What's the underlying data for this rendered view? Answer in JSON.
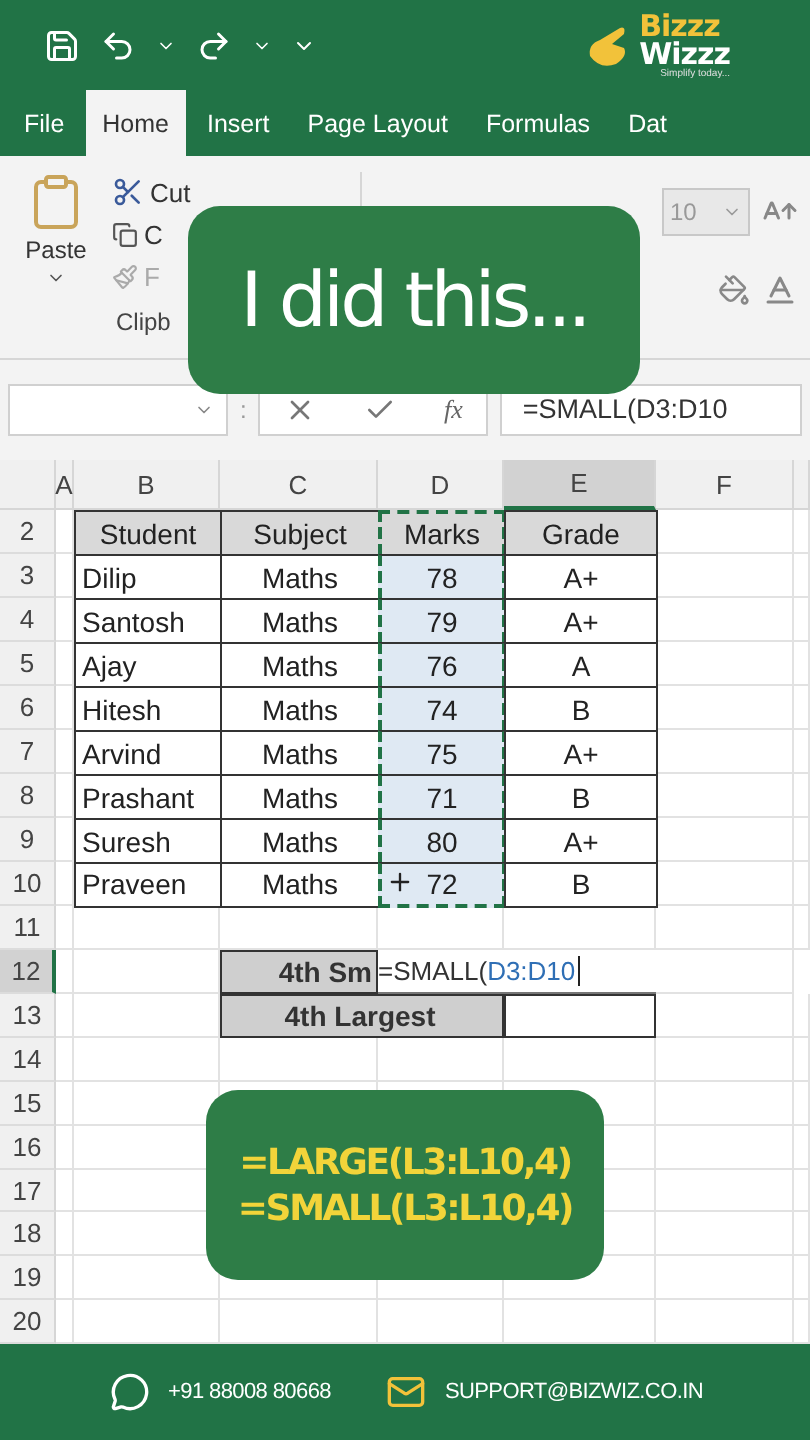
{
  "logo": {
    "line_1": "Bizzz",
    "line_2": "Wizzz",
    "tagline": "Simplify today..."
  },
  "tabs": [
    {
      "label": "File",
      "selected": false
    },
    {
      "label": "Home",
      "selected": true
    },
    {
      "label": "Insert",
      "selected": false
    },
    {
      "label": "Page Layout",
      "selected": false
    },
    {
      "label": "Formulas",
      "selected": false
    },
    {
      "label": "Dat",
      "selected": false
    }
  ],
  "ribbon": {
    "paste": "Paste",
    "cut": "Cut",
    "copy": "C",
    "format_painter": "F",
    "group_label": "Clipb",
    "font_size": "10"
  },
  "caption_top": "I did this...",
  "formula_bar": {
    "separator": ":",
    "function_label": "fx",
    "formula": "=SMALL(D3:D10"
  },
  "column_letters": [
    {
      "label": "A",
      "selected": false
    },
    {
      "label": "B",
      "selected": false
    },
    {
      "label": "C",
      "selected": false
    },
    {
      "label": "D",
      "selected": false
    },
    {
      "label": "E",
      "selected": true
    },
    {
      "label": "F",
      "selected": false
    }
  ],
  "row_numbers": [
    {
      "label": "2",
      "selected": false
    },
    {
      "label": "3",
      "selected": false
    },
    {
      "label": "4",
      "selected": false
    },
    {
      "label": "5",
      "selected": false
    },
    {
      "label": "6",
      "selected": false
    },
    {
      "label": "7",
      "selected": false
    },
    {
      "label": "8",
      "selected": false
    },
    {
      "label": "9",
      "selected": false
    },
    {
      "label": "10",
      "selected": false
    },
    {
      "label": "11",
      "selected": false
    },
    {
      "label": "12",
      "selected": true
    },
    {
      "label": "13",
      "selected": false
    },
    {
      "label": "14",
      "selected": false
    },
    {
      "label": "15",
      "selected": false
    },
    {
      "label": "16",
      "selected": false
    },
    {
      "label": "17",
      "selected": false
    },
    {
      "label": "18",
      "selected": false
    },
    {
      "label": "19",
      "selected": false
    },
    {
      "label": "20",
      "selected": false
    }
  ],
  "table": {
    "columns": [
      {
        "label": "Student",
        "selected": false
      },
      {
        "label": "Subject",
        "selected": false
      },
      {
        "label": "Marks",
        "selected": true
      },
      {
        "label": "Grade",
        "selected": false
      }
    ],
    "rows": [
      [
        "Dilip",
        "Maths",
        "78",
        "A+"
      ],
      [
        "Santosh",
        "Maths",
        "79",
        "A+"
      ],
      [
        "Ajay",
        "Maths",
        "76",
        "A"
      ],
      [
        "Hitesh",
        "Maths",
        "74",
        "B"
      ],
      [
        "Arvind",
        "Maths",
        "75",
        "A+"
      ],
      [
        "Prashant",
        "Maths",
        "71",
        "B"
      ],
      [
        "Suresh",
        "Maths",
        "80",
        "A+"
      ],
      [
        "Praveen",
        "Maths",
        "72",
        "B"
      ]
    ]
  },
  "summary": {
    "smallest_label": "4th Sm",
    "editor_function": "=SMALL(",
    "editor_range": "D3:D10",
    "largest_label": "4th Largest"
  },
  "caption_bottom": [
    "=LARGE(L3:L10,4)",
    "=SMALL(L3:L10,4)"
  ],
  "footer": {
    "phone": "+91 88008 80668",
    "email": "SUPPORT@BIZWIZ.CO.IN"
  }
}
